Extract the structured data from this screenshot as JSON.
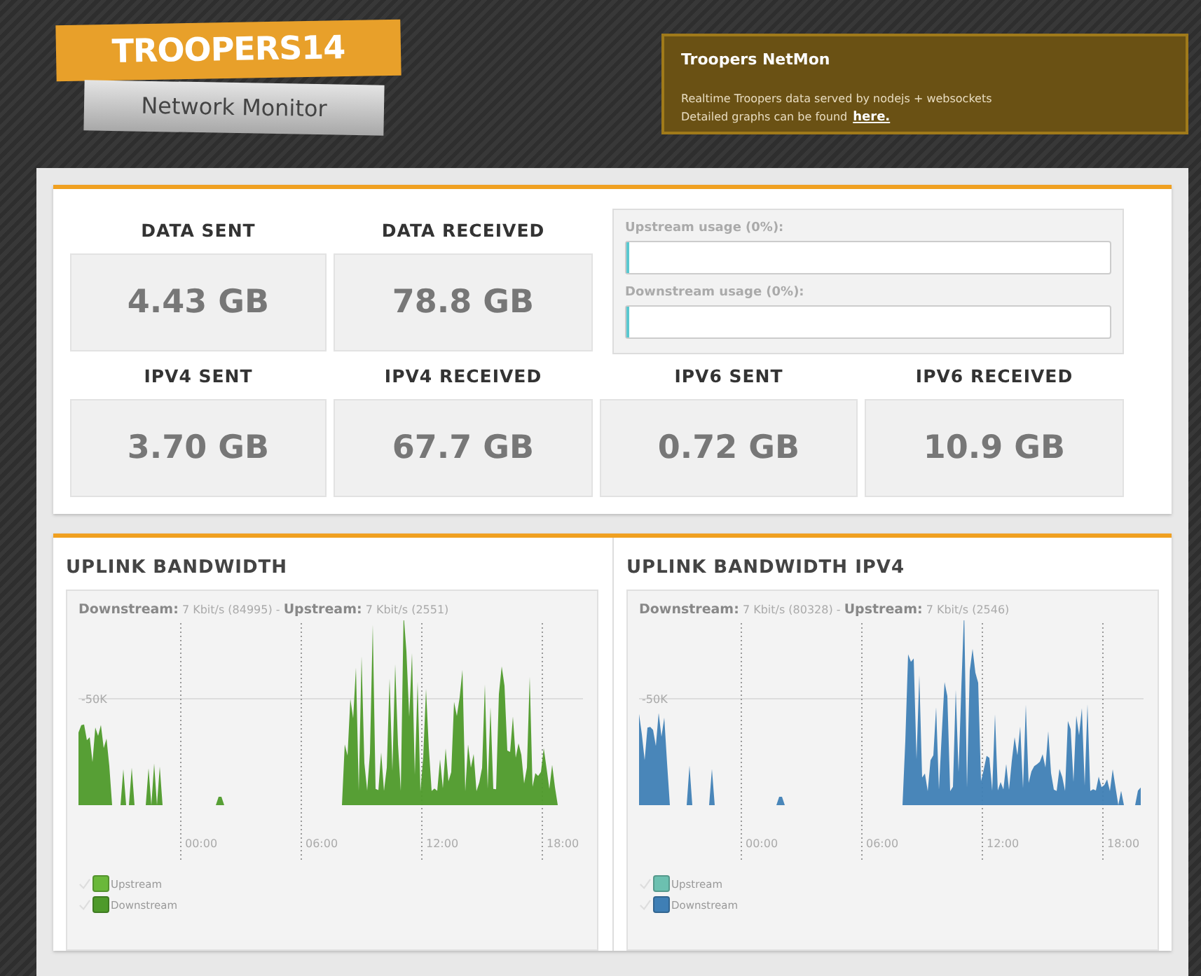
{
  "logo": {
    "title": "TROOPERS14",
    "subtitle": "Network Monitor"
  },
  "info": {
    "title": "Troopers NetMon",
    "line_1": "Realtime Troopers data served by nodejs + websockets",
    "line_2": "Detailed graphs can be found",
    "link": "here."
  },
  "totals": [
    {
      "label": "DATA SENT",
      "value": "4.43 GB"
    },
    {
      "label": "DATA RECEIVED",
      "value": "78.8 GB"
    }
  ],
  "usage": [
    {
      "label": "Upstream usage (0%):",
      "level": 0
    },
    {
      "label": "Downstream usage (0%):",
      "level": 0
    }
  ],
  "protocols": [
    {
      "label": "IPV4 SENT",
      "value": "3.70 GB"
    },
    {
      "label": "IPV4 RECEIVED",
      "value": "67.7 GB"
    },
    {
      "label": "IPV6 SENT",
      "value": "0.72 GB"
    },
    {
      "label": "IPV6 RECEIVED",
      "value": "10.9 GB"
    }
  ],
  "graphs": [
    {
      "title": "UPLINK BANDWIDTH",
      "down_label": "Downstream:",
      "down_value": "7 Kbit/s (84995)",
      "separator": "-",
      "up_label": "Upstream:",
      "up_value": "7 Kbit/s (2551)",
      "y_tick": "-50K",
      "x_ticks": [
        "00:00",
        "06:00",
        "12:00",
        "18:00"
      ],
      "legend": [
        {
          "name": "Upstream",
          "color": "#6ab83a",
          "checked": true
        },
        {
          "name": "Downstream",
          "color": "#4e9a2a",
          "checked": true
        }
      ]
    },
    {
      "title": "UPLINK BANDWIDTH IPV4",
      "down_label": "Downstream:",
      "down_value": "7 Kbit/s (80328)",
      "separator": "-",
      "up_label": "Upstream:",
      "up_value": "7 Kbit/s (2546)",
      "y_tick": "-50K",
      "x_ticks": [
        "00:00",
        "06:00",
        "12:00",
        "18:00"
      ],
      "legend": [
        {
          "name": "Upstream",
          "color": "#6cc0b0",
          "checked": true
        },
        {
          "name": "Downstream",
          "color": "#3f7fb5",
          "checked": true
        }
      ]
    }
  ]
}
